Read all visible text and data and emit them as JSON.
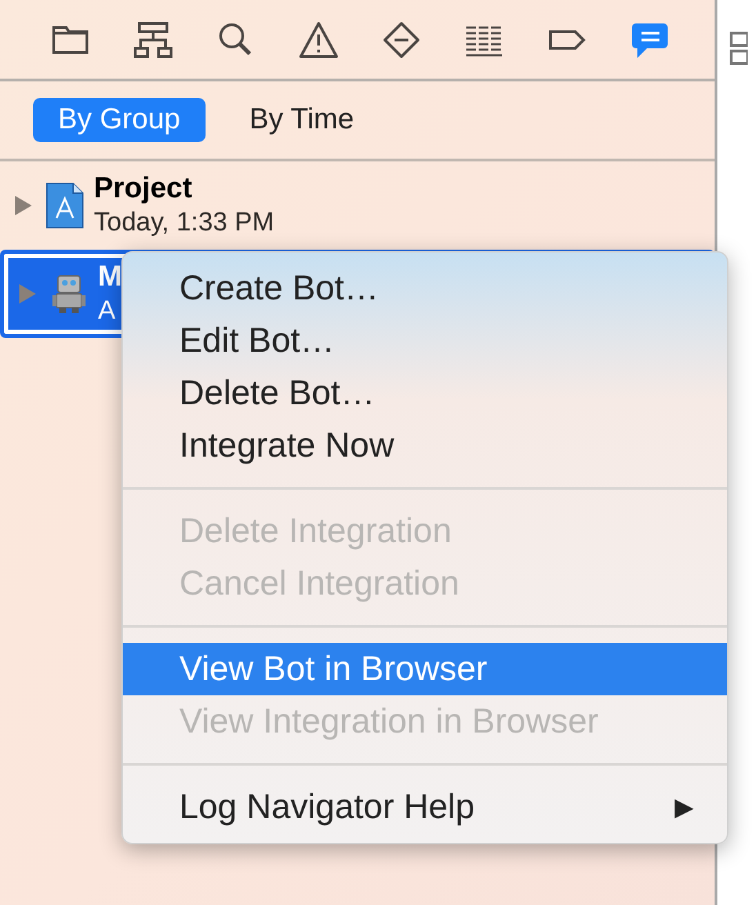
{
  "toolbar": [
    {
      "kind": "folder",
      "selected": false
    },
    {
      "kind": "hierarchy",
      "selected": false
    },
    {
      "kind": "search",
      "selected": false
    },
    {
      "kind": "warning",
      "selected": false
    },
    {
      "kind": "breakpoint",
      "selected": false
    },
    {
      "kind": "list",
      "selected": false
    },
    {
      "kind": "tag",
      "selected": false
    },
    {
      "kind": "chat",
      "selected": true
    }
  ],
  "segments": [
    {
      "label": "By Group",
      "selected": true
    },
    {
      "label": "By Time",
      "selected": false
    }
  ],
  "rows": [
    {
      "kind": "project",
      "title": "Project",
      "subtitle": "Today, 1:33 PM",
      "selected": false
    },
    {
      "kind": "bot",
      "title": "M",
      "subtitle": "A",
      "selected": true
    }
  ],
  "menu": [
    {
      "kind": "item",
      "label": "Create Bot…",
      "disabled": false,
      "selected": false
    },
    {
      "kind": "item",
      "label": "Edit Bot…",
      "disabled": false,
      "selected": false
    },
    {
      "kind": "item",
      "label": "Delete Bot…",
      "disabled": false,
      "selected": false
    },
    {
      "kind": "item",
      "label": "Integrate Now",
      "disabled": false,
      "selected": false
    },
    {
      "kind": "separator"
    },
    {
      "kind": "item",
      "label": "Delete Integration",
      "disabled": true,
      "selected": false
    },
    {
      "kind": "item",
      "label": "Cancel Integration",
      "disabled": true,
      "selected": false
    },
    {
      "kind": "separator"
    },
    {
      "kind": "item",
      "label": "View Bot in Browser",
      "disabled": false,
      "selected": true
    },
    {
      "kind": "item",
      "label": "View Integration in Browser",
      "disabled": true,
      "selected": false
    },
    {
      "kind": "separator"
    },
    {
      "kind": "item",
      "label": "Log Navigator Help",
      "disabled": false,
      "selected": false,
      "submenu": "▶"
    }
  ]
}
